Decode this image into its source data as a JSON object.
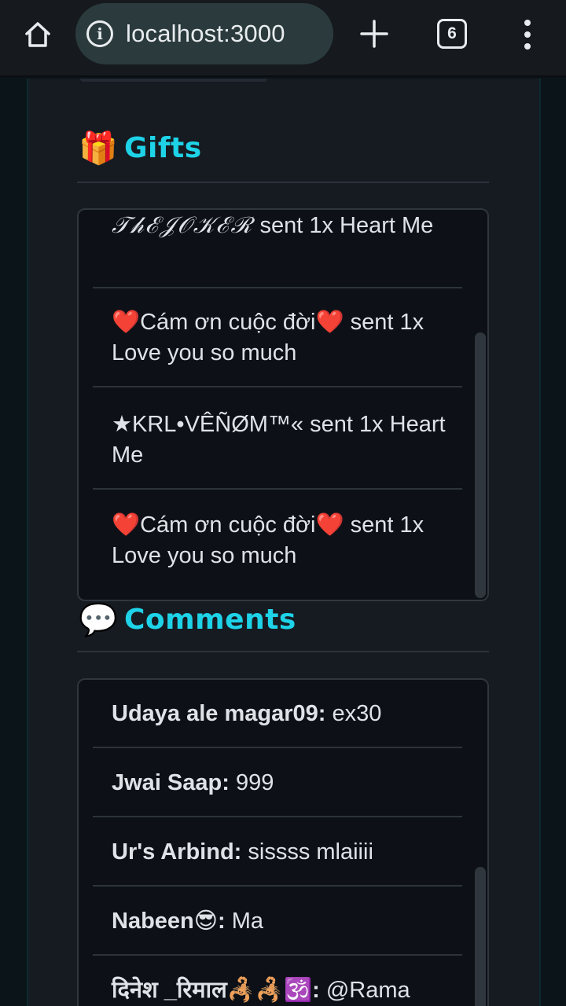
{
  "browser": {
    "url": "localhost:3000",
    "tab_count": "6",
    "home_icon": "home-icon",
    "info_icon": "info-icon",
    "new_tab_icon": "plus-icon",
    "menu_icon": "more-vert-icon"
  },
  "gifts": {
    "emoji": "🎁",
    "title": "Gifts",
    "items": [
      {
        "user": "𝒯𝒽ℰ𝒥𝒪𝒦ℰℛ",
        "text": "sent 1x Heart Me"
      },
      {
        "user": "❤️Cám ơn cuộc đời❤️",
        "text": "sent 1x Love you so much"
      },
      {
        "user": "★KRL•VÊÑØM™«",
        "text": "sent 1x Heart Me"
      },
      {
        "user": "❤️Cám ơn cuộc đời❤️",
        "text": "sent 1x Love you so much"
      }
    ]
  },
  "comments": {
    "emoji": "💬",
    "title": "Comments",
    "items": [
      {
        "user": "Udaya ale magar09:",
        "text": "ex30"
      },
      {
        "user": "Jwai Saap:",
        "text": "999"
      },
      {
        "user": "Ur's Arbind:",
        "text": "sissss mlaiiii"
      },
      {
        "user": "Nabeen😎:",
        "text": "Ma"
      },
      {
        "user": "दिनेश _रिमाल🦂🦂🕉️:",
        "text": "@Rama"
      }
    ]
  },
  "colors": {
    "accent": "#1ed3e8",
    "panel": "#161b22",
    "box": "#0d1117",
    "border": "#30363d"
  }
}
